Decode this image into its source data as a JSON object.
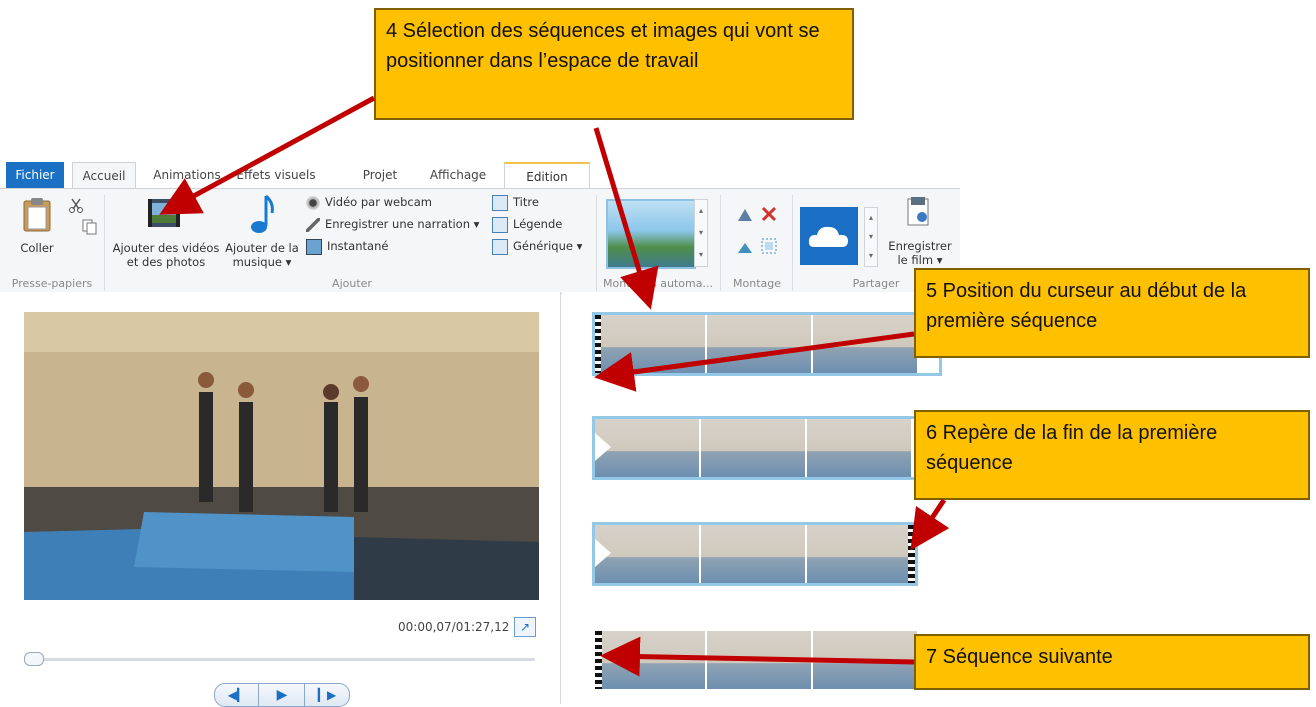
{
  "ribbon": {
    "tabs": [
      "Fichier",
      "Accueil",
      "Animations",
      "Effets visuels",
      "Projet",
      "Affichage",
      "Edition"
    ],
    "clipboard": {
      "paste": "Coller",
      "group": "Presse-papiers"
    },
    "add": {
      "add_videos_line1": "Ajouter des vidéos",
      "add_videos_line2": "et des photos",
      "add_music_line1": "Ajouter de la",
      "add_music_line2": "musique",
      "webcam": "Vidéo par webcam",
      "narration": "Enregistrer une narration",
      "snapshot": "Instantané",
      "title": "Titre",
      "caption": "Légende",
      "credits": "Générique",
      "group": "Ajouter"
    },
    "automovie_group": "Montages automa...",
    "montage_group": "Montage",
    "share": {
      "save_line1": "Enregistrer",
      "save_line2": "le film",
      "group": "Partager"
    }
  },
  "preview": {
    "time": "00:00,07/01:27,12",
    "progress": 0.001
  },
  "callouts": {
    "c4": "4 Sélection des séquences et images qui vont se positionner dans l’espace de travail",
    "c5": "5 Position du curseur au début de la première séquence",
    "c6": "6 Repère de la fin de la première séquence",
    "c7": "7 Séquence suivante"
  },
  "colors": {
    "callout_bg": "#ffc000",
    "arrow": "#c00000",
    "fichier_tab": "#1a71c4",
    "clip_border": "#93c8e6"
  },
  "icons": [
    "paste-icon",
    "cut-icon",
    "copy-icon",
    "add-video-icon",
    "music-note-icon",
    "webcam-icon",
    "microphone-icon",
    "snapshot-icon",
    "title-icon",
    "caption-icon",
    "credits-icon",
    "onedrive-icon",
    "save-movie-icon",
    "play-icon",
    "previous-frame-icon",
    "next-frame-icon",
    "fullscreen-icon"
  ]
}
